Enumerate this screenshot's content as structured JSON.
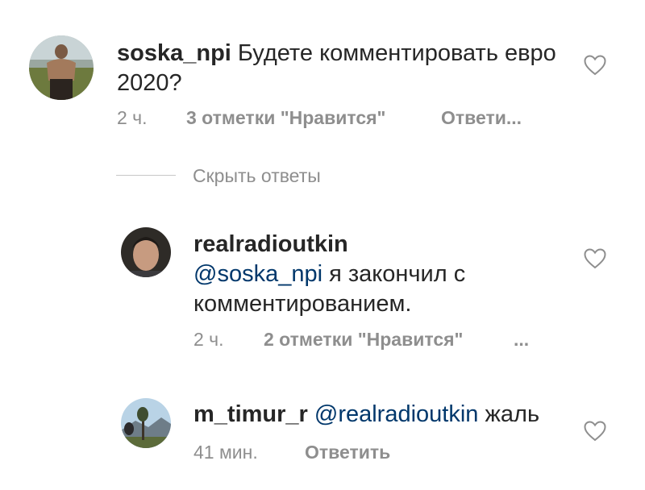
{
  "comments": [
    {
      "username": "soska_npi",
      "text": "Будете комментировать евро 2020?",
      "time": "2 ч.",
      "likes": "3 отметки \"Нравится\"",
      "reply": "Ответи..."
    },
    {
      "username": "realradioutkin",
      "mention": "@soska_npi",
      "text": "я закончил с комментированием.",
      "time": "2 ч.",
      "likes": "2 отметки \"Нравится\"",
      "more": "..."
    },
    {
      "username": "m_timur_r",
      "mention": "@realradioutkin",
      "text": "жаль",
      "time": "41 мин.",
      "reply": "Ответить"
    }
  ],
  "hide_replies": "Скрыть ответы",
  "icons": {
    "like": "heart-outline-icon"
  },
  "colors": {
    "text": "#262626",
    "secondary": "#8e8e8e",
    "mention": "#00376b"
  }
}
